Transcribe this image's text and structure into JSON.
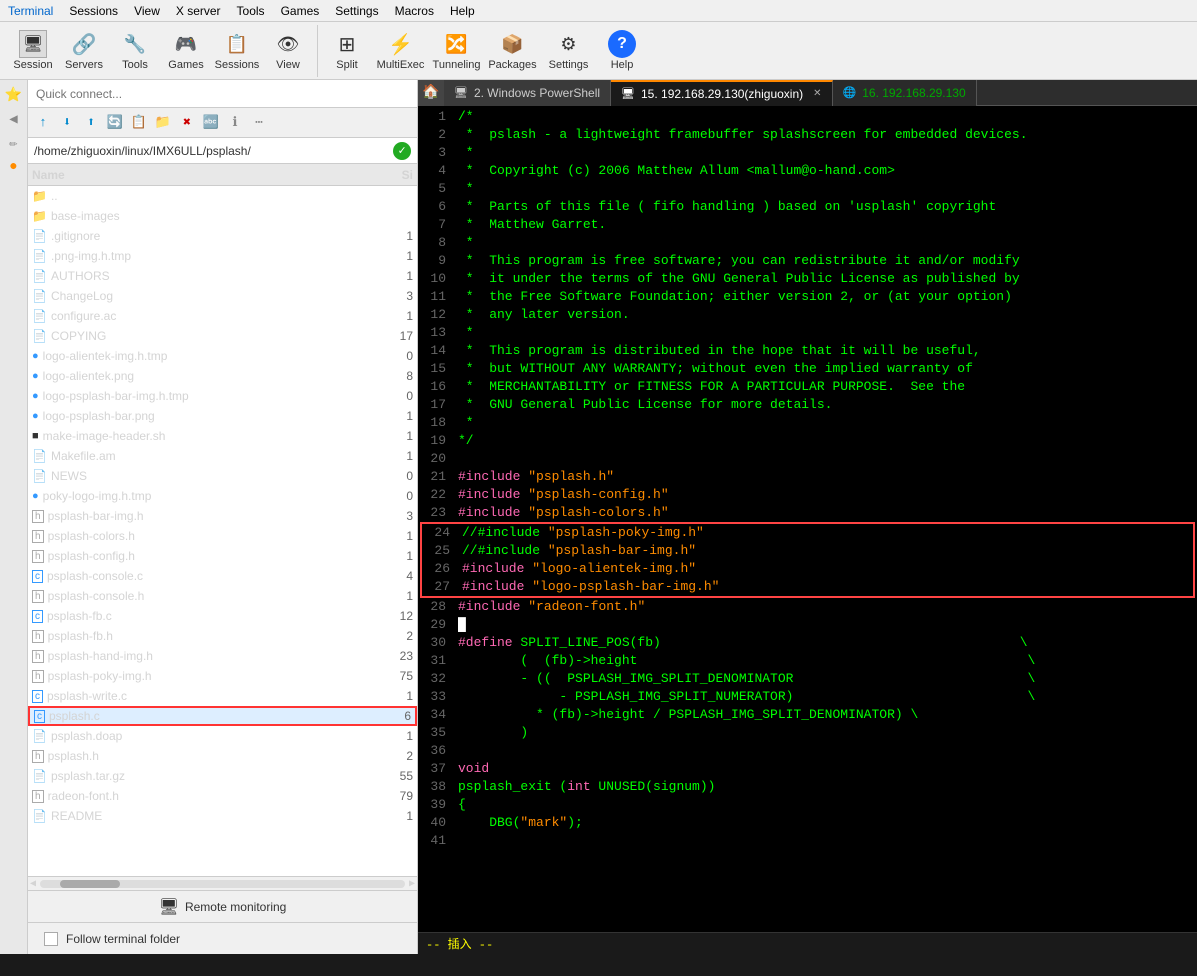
{
  "menubar": {
    "items": [
      "Terminal",
      "Sessions",
      "View",
      "X server",
      "Tools",
      "Games",
      "Settings",
      "Macros",
      "Help"
    ]
  },
  "toolbar": {
    "groups": [
      {
        "buttons": [
          {
            "label": "Session",
            "icon": "🖥"
          },
          {
            "label": "Servers",
            "icon": "🔗"
          },
          {
            "label": "Tools",
            "icon": "🔧"
          },
          {
            "label": "Games",
            "icon": "🎮"
          },
          {
            "label": "Sessions",
            "icon": "📋"
          },
          {
            "label": "View",
            "icon": "👁"
          }
        ]
      },
      {
        "buttons": [
          {
            "label": "Split",
            "icon": "⊞"
          },
          {
            "label": "MultiExec",
            "icon": "⚡"
          },
          {
            "label": "Tunneling",
            "icon": "🔀"
          },
          {
            "label": "Packages",
            "icon": "📦"
          },
          {
            "label": "Settings",
            "icon": "⚙"
          },
          {
            "label": "Help",
            "icon": "?"
          }
        ]
      }
    ]
  },
  "left_panel": {
    "quick_connect_placeholder": "Quick connect...",
    "path": "/home/zhiguoxin/linux/IMX6ULL/psplash/",
    "file_list_header": {
      "name": "Name",
      "size": "Si"
    },
    "files": [
      {
        "name": "..",
        "icon": "📁",
        "type": "folder_up",
        "size": ""
      },
      {
        "name": "base-images",
        "icon": "📁",
        "type": "folder",
        "size": ""
      },
      {
        "name": ".gitignore",
        "icon": "📄",
        "type": "file",
        "size": "1"
      },
      {
        "name": ".png-img.h.tmp",
        "icon": "📄",
        "type": "file",
        "size": "1"
      },
      {
        "name": "AUTHORS",
        "icon": "📄",
        "type": "file",
        "size": "1"
      },
      {
        "name": "ChangeLog",
        "icon": "📄",
        "type": "file",
        "size": "3"
      },
      {
        "name": "configure.ac",
        "icon": "📄",
        "type": "file",
        "size": "1"
      },
      {
        "name": "COPYING",
        "icon": "📄",
        "type": "file",
        "size": "17"
      },
      {
        "name": "logo-alientek-img.h.tmp",
        "icon": "🔵",
        "type": "special",
        "size": "0"
      },
      {
        "name": "logo-alientek.png",
        "icon": "🔵",
        "type": "special",
        "size": "8"
      },
      {
        "name": "logo-psplash-bar-img.h.tmp",
        "icon": "🔵",
        "type": "special",
        "size": "0"
      },
      {
        "name": "logo-psplash-bar.png",
        "icon": "🔵",
        "type": "special",
        "size": "1"
      },
      {
        "name": "make-image-header.sh",
        "icon": "📄",
        "type": "file",
        "size": "1"
      },
      {
        "name": "Makefile.am",
        "icon": "📄",
        "type": "file",
        "size": "1"
      },
      {
        "name": "NEWS",
        "icon": "📄",
        "type": "file",
        "size": "0"
      },
      {
        "name": "poky-logo-img.h.tmp",
        "icon": "🔵",
        "type": "special",
        "size": "0"
      },
      {
        "name": "psplash-bar-img.h",
        "icon": "h",
        "type": "h_file",
        "size": "3"
      },
      {
        "name": "psplash-colors.h",
        "icon": "h",
        "type": "h_file",
        "size": "1"
      },
      {
        "name": "psplash-config.h",
        "icon": "h",
        "type": "h_file",
        "size": "1"
      },
      {
        "name": "psplash-console.c",
        "icon": "c",
        "type": "c_file",
        "size": "4"
      },
      {
        "name": "psplash-console.h",
        "icon": "h",
        "type": "h_file",
        "size": "1"
      },
      {
        "name": "psplash-fb.c",
        "icon": "c",
        "type": "c_file",
        "size": "12"
      },
      {
        "name": "psplash-fb.h",
        "icon": "h",
        "type": "h_file",
        "size": "2"
      },
      {
        "name": "psplash-hand-img.h",
        "icon": "h",
        "type": "h_file",
        "size": "23"
      },
      {
        "name": "psplash-poky-img.h",
        "icon": "h",
        "type": "h_file",
        "size": "75"
      },
      {
        "name": "psplash-write.c",
        "icon": "c",
        "type": "c_file",
        "size": "1"
      },
      {
        "name": "psplash.c",
        "icon": "c",
        "type": "c_file_selected",
        "size": "6"
      },
      {
        "name": "psplash.doap",
        "icon": "📄",
        "type": "file",
        "size": "1"
      },
      {
        "name": "psplash.h",
        "icon": "h",
        "type": "h_file",
        "size": "2"
      },
      {
        "name": "psplash.tar.gz",
        "icon": "📄",
        "type": "archive",
        "size": "55"
      },
      {
        "name": "radeon-font.h",
        "icon": "h",
        "type": "h_file",
        "size": "79"
      },
      {
        "name": "README",
        "icon": "📄",
        "type": "file",
        "size": "1"
      }
    ],
    "remote_monitoring_label": "Remote monitoring",
    "follow_terminal_label": "Follow terminal folder"
  },
  "tabs": [
    {
      "label": "2. Windows PowerShell",
      "icon": "🖥",
      "active": false
    },
    {
      "label": "15. 192.168.29.130(zhiguoxin)",
      "icon": "🖥",
      "active": true
    },
    {
      "label": "16. 192.168.29.130",
      "icon": "🌐",
      "active": false
    }
  ],
  "code": {
    "lines": [
      {
        "num": 1,
        "content": "/*",
        "style": "comment"
      },
      {
        "num": 2,
        "content": " *  pslash - a lightweight framebuffer splashscreen for embedded devices.",
        "style": "comment"
      },
      {
        "num": 3,
        "content": " *",
        "style": "comment"
      },
      {
        "num": 4,
        "content": " *  Copyright (c) 2006 Matthew Allum <mallum@o-hand.com>",
        "style": "comment"
      },
      {
        "num": 5,
        "content": " *",
        "style": "comment"
      },
      {
        "num": 6,
        "content": " *  Parts of this file ( fifo handling ) based on 'usplash' copyright",
        "style": "comment"
      },
      {
        "num": 7,
        "content": " *  Matthew Garret.",
        "style": "comment"
      },
      {
        "num": 8,
        "content": " *",
        "style": "comment"
      },
      {
        "num": 9,
        "content": " *  This program is free software; you can redistribute it and/or modify",
        "style": "comment"
      },
      {
        "num": 10,
        "content": " *  it under the terms of the GNU General Public License as published by",
        "style": "comment"
      },
      {
        "num": 11,
        "content": " *  the Free Software Foundation; either version 2, or (at your option)",
        "style": "comment"
      },
      {
        "num": 12,
        "content": " *  any later version.",
        "style": "comment"
      },
      {
        "num": 13,
        "content": " *",
        "style": "comment"
      },
      {
        "num": 14,
        "content": " *  This program is distributed in the hope that it will be useful,",
        "style": "comment"
      },
      {
        "num": 15,
        "content": " *  but WITHOUT ANY WARRANTY; without even the implied warranty of",
        "style": "comment"
      },
      {
        "num": 16,
        "content": " *  MERCHANTABILITY or FITNESS FOR A PARTICULAR PURPOSE.  See the",
        "style": "comment"
      },
      {
        "num": 17,
        "content": " *  GNU General Public License for more details.",
        "style": "comment"
      },
      {
        "num": 18,
        "content": " *",
        "style": "comment"
      },
      {
        "num": 19,
        "content": "*/",
        "style": "comment"
      },
      {
        "num": 20,
        "content": "",
        "style": "normal"
      },
      {
        "num": 21,
        "content": "#include \"psplash.h\"",
        "style": "include"
      },
      {
        "num": 22,
        "content": "#include \"psplash-config.h\"",
        "style": "include"
      },
      {
        "num": 23,
        "content": "#include \"psplash-colors.h\"",
        "style": "include"
      },
      {
        "num": 24,
        "content": "//#include \"psplash-poky-img.h\"",
        "style": "include_highlight"
      },
      {
        "num": 25,
        "content": "//#include \"psplash-bar-img.h\"",
        "style": "include_highlight"
      },
      {
        "num": 26,
        "content": "#include \"logo-alientek-img.h\"",
        "style": "include_highlight"
      },
      {
        "num": 27,
        "content": "#include \"logo-psplash-bar-img.h\"",
        "style": "include_highlight"
      },
      {
        "num": 28,
        "content": "#include \"radeon-font.h\"",
        "style": "include"
      },
      {
        "num": 29,
        "content": "",
        "style": "normal"
      },
      {
        "num": 30,
        "content": "#define SPLIT_LINE_POS(fb)                                              \\",
        "style": "define"
      },
      {
        "num": 31,
        "content": "        (  (fb)->height                                                  \\",
        "style": "normal"
      },
      {
        "num": 32,
        "content": "        - ((  PSPLASH_IMG_SPLIT_DENOMINATOR                              \\",
        "style": "normal"
      },
      {
        "num": 33,
        "content": "             - PSPLASH_IMG_SPLIT_NUMERATOR)                              \\",
        "style": "normal"
      },
      {
        "num": 34,
        "content": "          * (fb)->height / PSPLASH_IMG_SPLIT_DENOMINATOR) \\",
        "style": "normal"
      },
      {
        "num": 35,
        "content": "        )",
        "style": "normal"
      },
      {
        "num": 36,
        "content": "",
        "style": "normal"
      },
      {
        "num": 37,
        "content": "void",
        "style": "keyword"
      },
      {
        "num": 38,
        "content": "psplash_exit (int UNUSED(signum))",
        "style": "normal"
      },
      {
        "num": 39,
        "content": "{",
        "style": "normal"
      },
      {
        "num": 40,
        "content": "    DBG(\"mark\");",
        "style": "dbg"
      },
      {
        "num": 41,
        "content": "",
        "style": "normal"
      }
    ]
  },
  "status_bar": {
    "text": "-- 插入 --"
  }
}
